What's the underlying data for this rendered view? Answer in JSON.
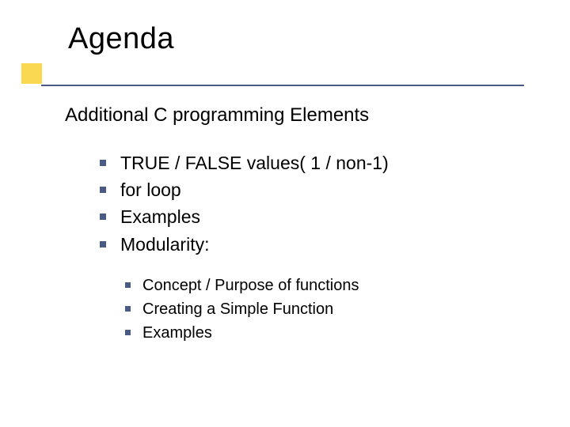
{
  "title": "Agenda",
  "subtitle": "Additional C programming Elements",
  "bullets": [
    "TRUE / FALSE values( 1 / non-1)",
    "for loop",
    "Examples",
    "Modularity:"
  ],
  "subbullets": [
    "Concept / Purpose of functions",
    "Creating a Simple Function",
    "Examples"
  ],
  "colors": {
    "accent": "#4a5b83",
    "highlight": "#fbd851"
  }
}
